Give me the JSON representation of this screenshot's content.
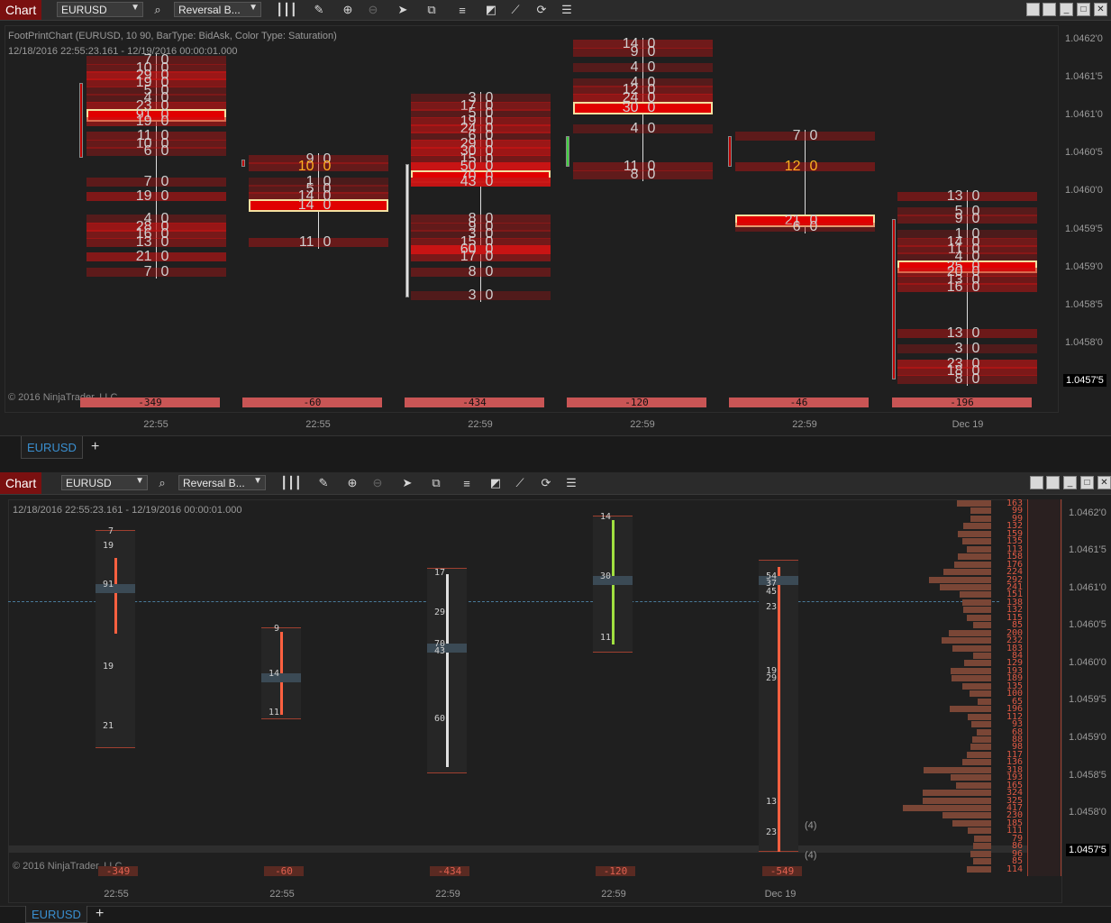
{
  "top_window": {
    "title": "Chart",
    "instrument": "EURUSD",
    "bar_type": "Reversal B...",
    "info_line1": "FootPrintChart (EURUSD, 10 90, BarType: BidAsk, Color Type: Saturation)",
    "info_line2": "12/18/2016 22:55:23.161 - 12/19/2016 00:00:01.000",
    "copyright": "© 2016 NinjaTrader, LLC",
    "price_labels": [
      "1.0462'0",
      "1.0461'5",
      "1.0461'0",
      "1.0460'5",
      "1.0460'0",
      "1.0459'5",
      "1.0459'0",
      "1.0458'5",
      "1.0458'0"
    ],
    "last_price": "1.0457'5",
    "time_labels": [
      "22:55",
      "22:55",
      "22:59",
      "22:59",
      "22:59",
      "Dec 19"
    ],
    "deltas": [
      "-349",
      "-60",
      "-434",
      "-120",
      "-46",
      "-196"
    ],
    "tab_label": "EURUSD",
    "bars": [
      {
        "rows": [
          [
            "7",
            "0"
          ],
          [
            "10",
            "0"
          ],
          [
            "29",
            "0"
          ],
          [
            "19",
            "0"
          ],
          [
            "5",
            "0"
          ],
          [
            "4",
            "0"
          ],
          [
            "23",
            "0"
          ],
          [
            "91",
            "0"
          ],
          [
            "19",
            "0"
          ],
          [
            "11",
            "0"
          ],
          [
            "10",
            "0"
          ],
          [
            "6",
            "0"
          ],
          [
            "7",
            "0"
          ],
          [
            "19",
            "0"
          ],
          [
            "4",
            "0"
          ],
          [
            "28",
            "0"
          ],
          [
            "16",
            "0"
          ],
          [
            "13",
            "0"
          ],
          [
            "21",
            "0"
          ],
          [
            "7",
            "0"
          ]
        ]
      },
      {
        "rows": [
          [
            "9",
            "0"
          ],
          [
            "10",
            "0"
          ],
          [
            "1",
            "0"
          ],
          [
            "5",
            "0"
          ],
          [
            "14",
            "0"
          ],
          [
            "14",
            "0"
          ],
          [
            "11",
            "0"
          ]
        ]
      },
      {
        "rows": [
          [
            "3",
            "0"
          ],
          [
            "17",
            "0"
          ],
          [
            "5",
            "0"
          ],
          [
            "19",
            "0"
          ],
          [
            "24",
            "0"
          ],
          [
            "6",
            "0"
          ],
          [
            "29",
            "0"
          ],
          [
            "30",
            "0"
          ],
          [
            "15",
            "0"
          ],
          [
            "50",
            "0"
          ],
          [
            "70",
            "0"
          ],
          [
            "43",
            "0"
          ],
          [
            "8",
            "0"
          ],
          [
            "9",
            "0"
          ],
          [
            "3",
            "0"
          ],
          [
            "15",
            "0"
          ],
          [
            "60",
            "0"
          ],
          [
            "17",
            "0"
          ],
          [
            "8",
            "0"
          ],
          [
            "3",
            "0"
          ]
        ]
      },
      {
        "rows": [
          [
            "14",
            "0"
          ],
          [
            "9",
            "0"
          ],
          [
            "4",
            "0"
          ],
          [
            "4",
            "0"
          ],
          [
            "12",
            "0"
          ],
          [
            "24",
            "0"
          ],
          [
            "30",
            "0"
          ],
          [
            "4",
            "0"
          ],
          [
            "11",
            "0"
          ],
          [
            "8",
            "0"
          ]
        ]
      },
      {
        "rows": [
          [
            "7",
            "0"
          ],
          [
            "12",
            "0"
          ],
          [
            "21",
            "0"
          ],
          [
            "6",
            "0"
          ]
        ]
      },
      {
        "rows": [
          [
            "13",
            "0"
          ],
          [
            "5",
            "0"
          ],
          [
            "9",
            "0"
          ],
          [
            "1",
            "0"
          ],
          [
            "14",
            "0"
          ],
          [
            "11",
            "0"
          ],
          [
            "4",
            "0"
          ],
          [
            "25",
            "0"
          ],
          [
            "20",
            "0"
          ],
          [
            "13",
            "0"
          ],
          [
            "16",
            "0"
          ],
          [
            "13",
            "0"
          ],
          [
            "3",
            "0"
          ],
          [
            "23",
            "0"
          ],
          [
            "18",
            "0"
          ],
          [
            "8",
            "0"
          ]
        ]
      }
    ]
  },
  "bottom_window": {
    "title": "Chart",
    "instrument": "EURUSD",
    "bar_type": "Reversal B...",
    "info_line": "12/18/2016 22:55:23.161 - 12/19/2016 00:00:01.000",
    "copyright": "© 2016 NinjaTrader, LLC",
    "price_labels": [
      "1.0462'0",
      "1.0461'5",
      "1.0461'0",
      "1.0460'5",
      "1.0460'0",
      "1.0459'5",
      "1.0459'0",
      "1.0458'5",
      "1.0458'0"
    ],
    "last_price": "1.0457'5",
    "time_labels": [
      "22:55",
      "22:55",
      "22:59",
      "22:59",
      "Dec 19"
    ],
    "deltas": [
      "-349",
      "-60",
      "-434",
      "-120",
      "-549"
    ],
    "annotations": [
      "(4)",
      "(4)"
    ],
    "tab_label": "EURUSD",
    "volume_profile": [
      "163",
      "99",
      "99",
      "132",
      "159",
      "135",
      "113",
      "158",
      "176",
      "224",
      "292",
      "241",
      "151",
      "138",
      "132",
      "115",
      "85",
      "200",
      "232",
      "183",
      "84",
      "129",
      "193",
      "189",
      "135",
      "100",
      "65",
      "196",
      "112",
      "93",
      "68",
      "88",
      "98",
      "117",
      "136",
      "318",
      "193",
      "165",
      "324",
      "325",
      "417",
      "230",
      "185",
      "111",
      "79",
      "86",
      "96",
      "85",
      "114"
    ]
  },
  "colors": {
    "accent_red": "#c00000",
    "tab_blue": "#3a8fd0",
    "delta_bg": "#c95555",
    "profile": "#7a4636"
  }
}
